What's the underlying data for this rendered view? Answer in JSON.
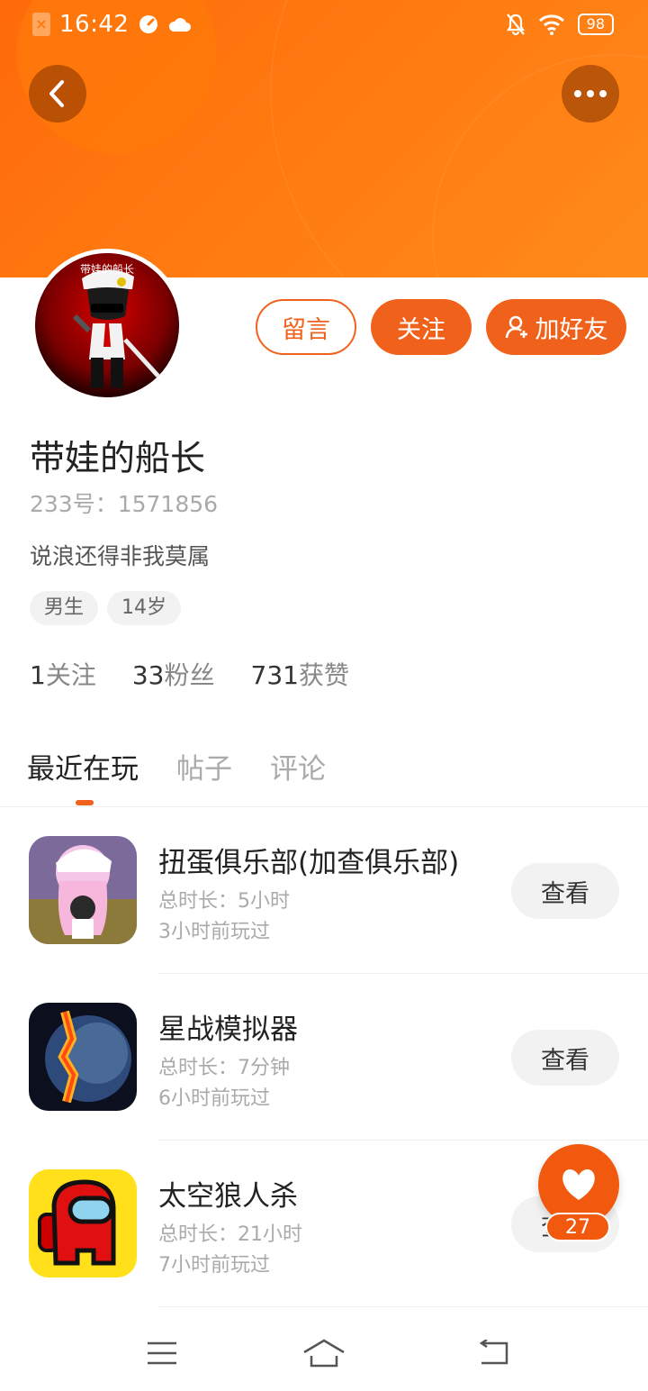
{
  "status_bar": {
    "time": "16:42",
    "battery": "98"
  },
  "profile": {
    "avatar_caption": "带娃的船长",
    "name": "带娃的船长",
    "id_label": "233号：1571856",
    "bio": "说浪还得非我莫属",
    "tags": [
      "男生",
      "14岁"
    ],
    "stats": [
      {
        "num": "1",
        "label": "关注"
      },
      {
        "num": "33",
        "label": "粉丝"
      },
      {
        "num": "731",
        "label": "获赞"
      }
    ]
  },
  "actions": {
    "message": "留言",
    "follow": "关注",
    "add_friend": "加好友"
  },
  "tabs": [
    "最近在玩",
    "帖子",
    "评论"
  ],
  "games": [
    {
      "title": "扭蛋俱乐部(加查俱乐部)",
      "duration": "总时长：5小时",
      "last_played": "3小时前玩过",
      "button": "查看"
    },
    {
      "title": "星战模拟器",
      "duration": "总时长：7分钟",
      "last_played": "6小时前玩过",
      "button": "查看"
    },
    {
      "title": "太空狼人杀",
      "duration": "总时长：21小时",
      "last_played": "7小时前玩过",
      "button": "查看"
    }
  ],
  "like": {
    "count": "27"
  },
  "colors": {
    "accent": "#f0621b",
    "header": "#ff7a10"
  }
}
